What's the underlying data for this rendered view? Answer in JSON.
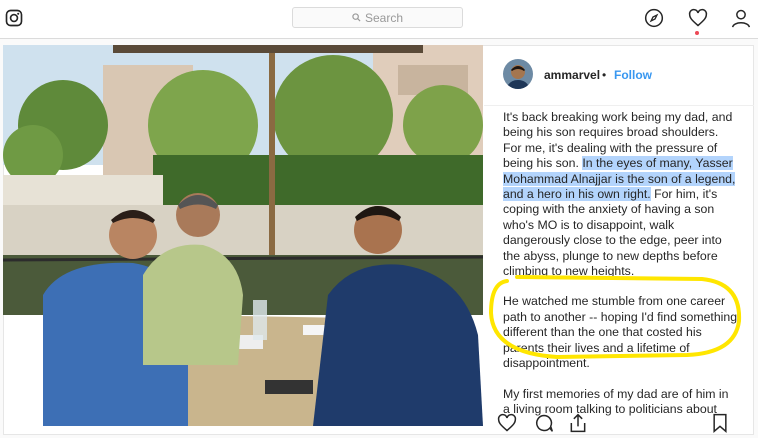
{
  "search": {
    "placeholder": "Search"
  },
  "nav": {
    "icons": [
      "instagram-icon",
      "compass-icon",
      "heart-icon",
      "profile-icon"
    ]
  },
  "post": {
    "username": "ammarvel",
    "separator": "•",
    "follow_label": "Follow",
    "caption": {
      "p1_a": "It's back breaking work being my dad, and being his son requires broad shoulders. For me, it's dealing with the pressure of being his son. ",
      "p1_highlight": "In the eyes of many, Yasser Mohammad Alnajjar is the son of a legend, and a hero in his own right.",
      "p1_b": " For him, it's coping with the anxiety of having a son who's MO is to disappoint, walk dangerously close to the edge, peer into the abyss, plunge to new depths before climbing to new heights.",
      "p2": "He watched me stumble from one career path to another -- hoping I'd find something different than the one that costed his parents their lives and a lifetime of disappointment.",
      "p3": "My first memories of my dad are of him in a living room talking to politicians about"
    },
    "annotation_color": "#ffe600",
    "highlight_color": "#b3d4fc",
    "link_color": "#3897f0"
  }
}
